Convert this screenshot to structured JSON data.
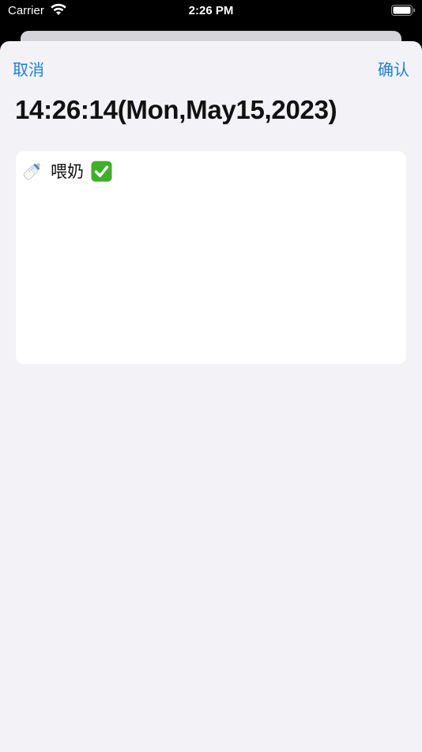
{
  "status_bar": {
    "carrier": "Carrier",
    "time": "2:26 PM",
    "wifi_icon": "wifi-icon",
    "battery_icon": "battery-icon"
  },
  "nav": {
    "cancel_label": "取消",
    "confirm_label": "确认"
  },
  "title": "14:26:14(Mon,May15,2023)",
  "note": {
    "leading_icon": "baby-bottle-icon",
    "text": "喂奶",
    "trailing_icon": "check-mark-button-icon"
  },
  "colors": {
    "accent": "#1e7ed8",
    "sheet_background": "#f2f2f7",
    "check_green": "#3fae2a"
  }
}
